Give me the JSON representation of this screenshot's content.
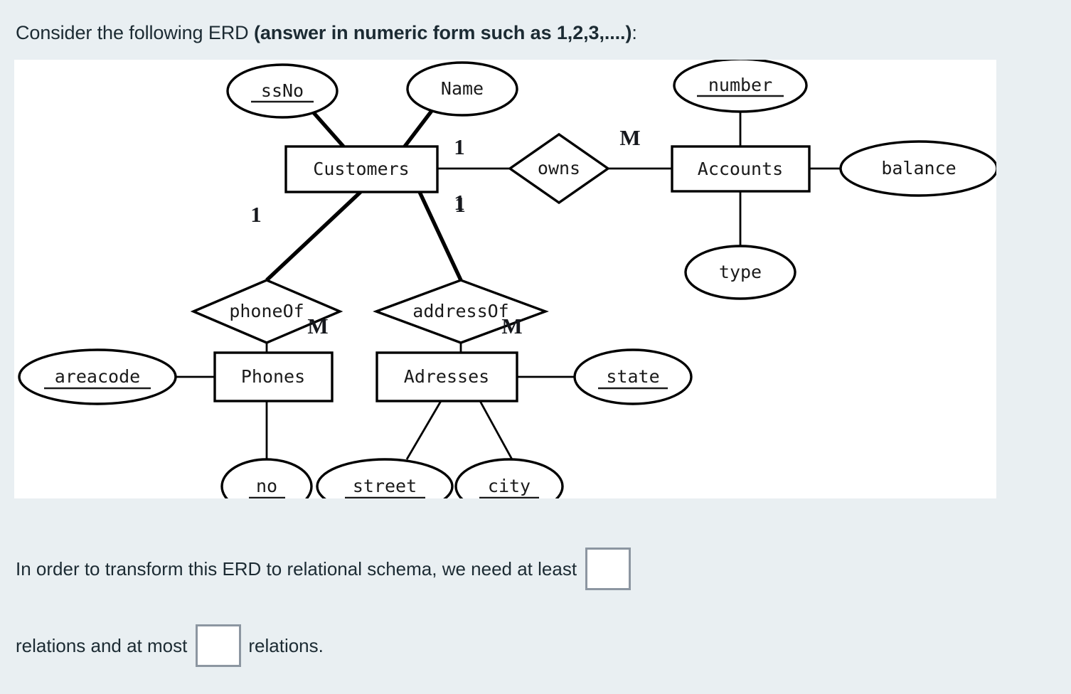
{
  "prompt": {
    "lead": "Consider the following ERD ",
    "emphasis": "(answer in numeric form such as 1,2,3,....)",
    "trail": ":"
  },
  "erd": {
    "entities": [
      {
        "id": "customers",
        "label": "Customers"
      },
      {
        "id": "accounts",
        "label": "Accounts"
      },
      {
        "id": "phones",
        "label": "Phones"
      },
      {
        "id": "adresses",
        "label": "Adresses"
      }
    ],
    "relationships": [
      {
        "id": "owns",
        "label": "owns"
      },
      {
        "id": "phoneof",
        "label": "phoneOf"
      },
      {
        "id": "addressof",
        "label": "addressOf"
      }
    ],
    "attributes": [
      {
        "id": "ssno",
        "label": "ssNo",
        "owner": "customers",
        "key": true
      },
      {
        "id": "name",
        "label": "Name",
        "owner": "customers",
        "key": false
      },
      {
        "id": "number",
        "label": "number",
        "owner": "accounts",
        "key": true
      },
      {
        "id": "balance",
        "label": "balance",
        "owner": "accounts",
        "key": false
      },
      {
        "id": "type",
        "label": "type",
        "owner": "accounts",
        "key": false
      },
      {
        "id": "areacode",
        "label": "areacode",
        "owner": "phones",
        "key": true
      },
      {
        "id": "no",
        "label": "no",
        "owner": "phones",
        "key": true
      },
      {
        "id": "street",
        "label": "street",
        "owner": "adresses",
        "key": true
      },
      {
        "id": "city",
        "label": "city",
        "owner": "adresses",
        "key": true
      },
      {
        "id": "state",
        "label": "state",
        "owner": "adresses",
        "key": true
      }
    ],
    "cardinalities": [
      {
        "id": "owns-customers-top",
        "label": "1"
      },
      {
        "id": "owns-customers-bottom",
        "label": "1"
      },
      {
        "id": "owns-accounts",
        "label": "M"
      },
      {
        "id": "phoneof-customers",
        "label": "1"
      },
      {
        "id": "phoneof-phones",
        "label": "M"
      },
      {
        "id": "addressof-customers",
        "label": "1"
      },
      {
        "id": "addressof-adresses",
        "label": "M"
      }
    ]
  },
  "question": {
    "line1_before": "In order to transform this ERD to relational schema, we need at least",
    "line2_before": "relations and at most",
    "line2_after": "relations.",
    "min_relations_value": "",
    "max_relations_value": ""
  }
}
